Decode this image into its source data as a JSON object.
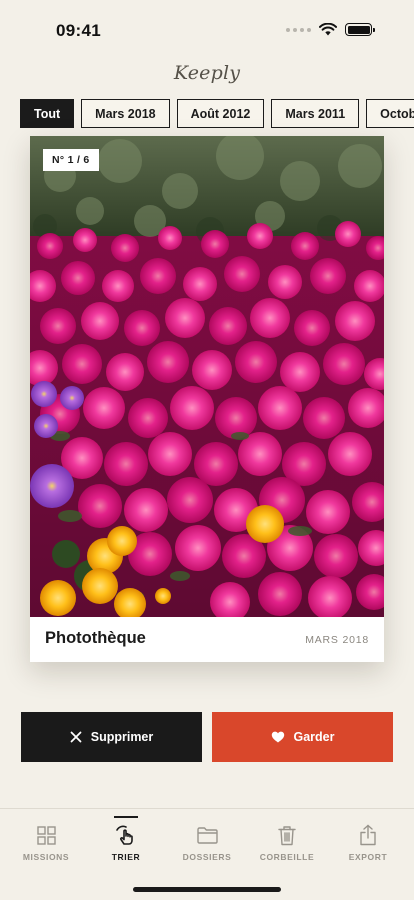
{
  "status_bar": {
    "time": "09:41"
  },
  "app": {
    "title": "Keeply"
  },
  "filters": [
    {
      "label": "Tout",
      "active": true
    },
    {
      "label": "Mars 2018",
      "active": false
    },
    {
      "label": "Août 2012",
      "active": false
    },
    {
      "label": "Mars 2011",
      "active": false
    },
    {
      "label": "Octobre",
      "active": false
    }
  ],
  "card": {
    "counter": "N° 1 / 6",
    "title": "Photothèque",
    "date": "MARS 2018"
  },
  "actions": {
    "delete_label": "Supprimer",
    "keep_label": "Garder"
  },
  "tabs": [
    {
      "label": "MISSIONS",
      "icon": "grid-icon",
      "active": false
    },
    {
      "label": "TRIER",
      "icon": "swipe-hand-icon",
      "active": true
    },
    {
      "label": "DOSSIERS",
      "icon": "folder-icon",
      "active": false
    },
    {
      "label": "CORBEILLE",
      "icon": "trash-icon",
      "active": false
    },
    {
      "label": "EXPORT",
      "icon": "share-icon",
      "active": false
    }
  ],
  "colors": {
    "background": "#f3f0e8",
    "accent": "#d9472b",
    "dark": "#1a1a1a",
    "muted": "#98948c"
  }
}
